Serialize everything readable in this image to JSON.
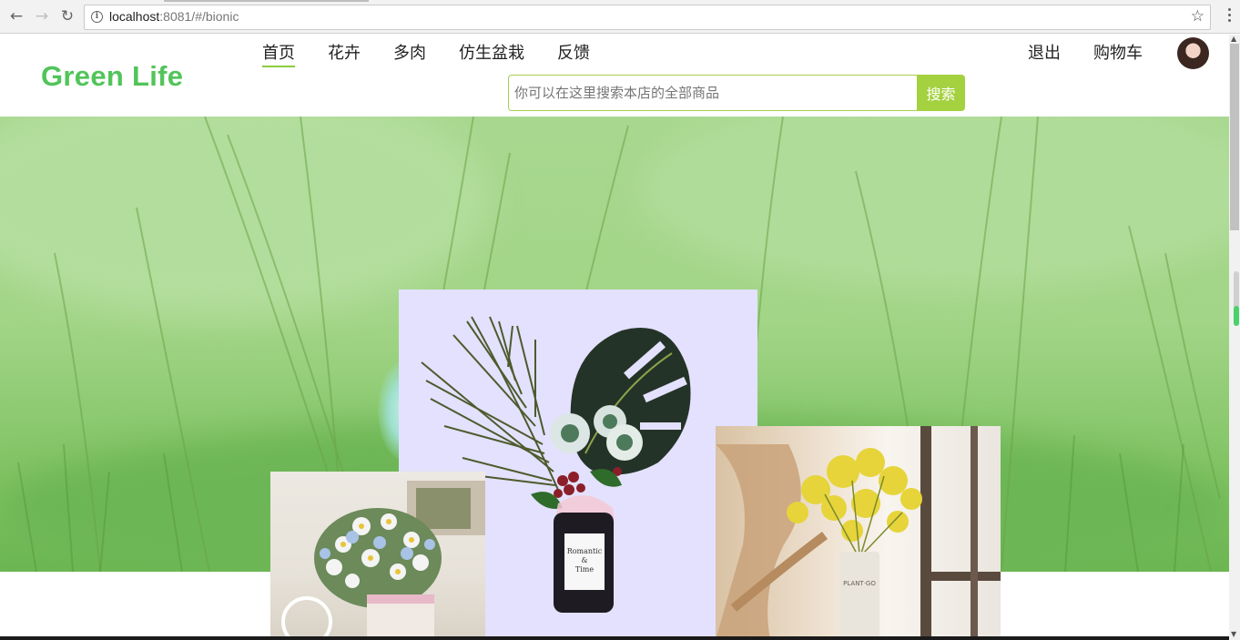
{
  "browser": {
    "url_host": "localhost",
    "url_rest": ":8081/#/bionic",
    "back_icon": "arrow-left-icon",
    "forward_icon": "arrow-right-icon",
    "reload_icon": "reload-icon",
    "info_icon": "info-icon",
    "bookmark_icon": "star-icon",
    "menu_icon": "more-vertical-icon"
  },
  "header": {
    "logo": "Green Life",
    "nav": [
      "首页",
      "花卉",
      "多肉",
      "仿生盆栽",
      "反馈"
    ],
    "active_nav": "首页",
    "right_nav": [
      "退出",
      "购物车"
    ],
    "search_placeholder": "你可以在这里搜索本店的全部商品",
    "search_button": "搜索",
    "accent_color": "#a4d13f",
    "logo_color": "#52c45a"
  },
  "hero": {
    "background": "green-grass-banner",
    "products": [
      {
        "name": "daisy-basket",
        "description_label": ""
      },
      {
        "name": "romantic-time-vase-bouquet",
        "label_line1": "Romantic",
        "label_line2": "&",
        "label_line3": "Time"
      },
      {
        "name": "yellow-flower-vase",
        "vase_text": "PLANT·GO"
      }
    ]
  }
}
